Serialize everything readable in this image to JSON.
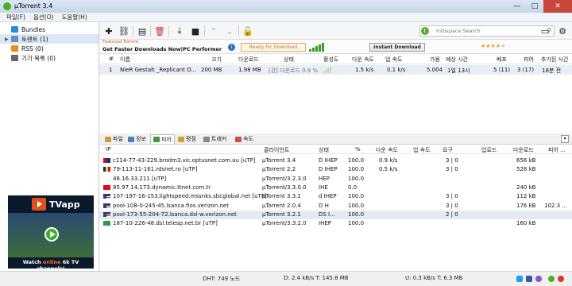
{
  "window": {
    "title": "µTorrent 3.4",
    "controls": [
      "—",
      "□",
      "✕"
    ]
  },
  "menu": [
    "파일(F)",
    "옵션(O)",
    "도움말(H)"
  ],
  "sidebar": {
    "items": [
      {
        "label": "Bundles",
        "color": "#1f8fd6"
      },
      {
        "label": "토렌트 (1)",
        "color": "#6b8fb8"
      },
      {
        "label": "RSS (0)",
        "color": "#f08a1c"
      },
      {
        "label": "기기 목록 (0)",
        "color": "#666666"
      }
    ],
    "ad": {
      "brand": "TVapp",
      "caption_pre": "Watch ",
      "caption_em": "online",
      "caption_post": " 6k TV channels!"
    }
  },
  "toolbar": {
    "buttons": [
      "add-icon",
      "link-icon",
      "file-icon",
      "delete-icon",
      "download-icon",
      "stop-icon",
      "up-icon",
      "down-icon",
      "unlock-icon"
    ],
    "search_placeholder": "Infospace Search",
    "right_icons": [
      "remote-icon",
      "chat-icon",
      "settings-icon"
    ]
  },
  "featured": {
    "label": "Featured Torrent",
    "title": "Get Faster Downloads Now|PC Performer",
    "ready": "Ready for Download",
    "instant": "Instant Download",
    "rating": 4
  },
  "torrents": {
    "columns": [
      "#",
      "이름",
      "크기",
      "다운로드",
      "상태",
      "활성도",
      "다운 속도",
      "업 속도",
      "가용",
      "예상 시간",
      "배포",
      "피어",
      "추가된 시간"
    ],
    "rows": [
      {
        "num": "1",
        "name": "NieR Gestalt _Replicant O...",
        "size": "200 MB",
        "done": "1.98 MB",
        "status": "[강] 다운로드 0.9 %",
        "down": "1.5 k/s",
        "up": "0.1 k/s",
        "avail": "5.004",
        "eta": "1일 13시",
        "seeds": "5 (11)",
        "peers": "3 (17)",
        "added": "18분 전"
      }
    ]
  },
  "tabs": [
    "파일",
    "정보",
    "피어",
    "평점",
    "트래커",
    "속도"
  ],
  "tab_colors": [
    "#c9a04a",
    "#4f7fc2",
    "#3f9a3f",
    "#d7a226",
    "#888888",
    "#d14d4d"
  ],
  "peers": {
    "columns": [
      "IP",
      "클라이언트",
      "상태",
      "%",
      "다운 속도",
      "업 속도",
      "요구",
      "업로드",
      "다운로드",
      "피어 ..."
    ],
    "rows": [
      {
        "flag": "au",
        "ip": "c114-77-43-229.brodm3.vic.optusnet.com.au [uTP]",
        "client": "µTorrent 3.4",
        "flags": "D IHEP",
        "pct": "100.0",
        "down": "0.9 k/s",
        "up": "",
        "req": "3 | 0",
        "upl": "",
        "dl": "656 kB",
        "peer": ""
      },
      {
        "flag": "ru",
        "ip": "79-113-11-161.rdsnet.ro [uTP]",
        "client": "µTorrent 2.2",
        "flags": "D IHEP",
        "pct": "100.0",
        "down": "0.5 k/s",
        "up": "",
        "req": "3 | 0",
        "upl": "",
        "dl": "528 kB",
        "peer": ""
      },
      {
        "flag": "",
        "ip": "46.16.33.211 [uTP]",
        "client": "µTorrent/3.2.3.0",
        "flags": "HEP",
        "pct": "100.0",
        "down": "",
        "up": "",
        "req": "",
        "upl": "",
        "dl": "",
        "peer": ""
      },
      {
        "flag": "tr",
        "ip": "85.97.14.173.dynamic.ttnet.com.tr",
        "client": "µTorrent/3.3.0.0",
        "flags": "IHE",
        "pct": "0.0",
        "down": "",
        "up": "",
        "req": "",
        "upl": "",
        "dl": "240 kB",
        "peer": ""
      },
      {
        "flag": "us",
        "ip": "107-197-16-153.lightspeed.mssnks.sbcglobal.net [uTP]",
        "client": "µTorrent 3.3.1",
        "flags": "d IHEP",
        "pct": "100.0",
        "down": "",
        "up": "",
        "req": "3 | 0",
        "upl": "",
        "dl": "112 kB",
        "peer": ""
      },
      {
        "flag": "us",
        "ip": "pool-108-0-245-45.lsanca.fios.verizon.net",
        "client": "µTorrent 2.0.4",
        "flags": "D H",
        "pct": "100.0",
        "down": "",
        "up": "",
        "req": "3 | 0",
        "upl": "",
        "dl": "176 kB",
        "peer": "102.3 ..."
      },
      {
        "flag": "us",
        "ip": "pool-173-55-204-72.lsanca.dsl-w.verizon.net",
        "client": "µTorrent 3.2.1",
        "flags": "DS I...",
        "pct": "100.0",
        "down": "",
        "up": "",
        "req": "2 | 0",
        "upl": "",
        "dl": "",
        "peer": ""
      },
      {
        "flag": "br",
        "ip": "187-10-226-48.dsl.telesp.net.br [uTP]",
        "client": "µTorrent/3.3.2.0",
        "flags": "IHEP",
        "pct": "100.0",
        "down": "",
        "up": "",
        "req": "",
        "upl": "",
        "dl": "160 kB",
        "peer": ""
      }
    ]
  },
  "status": {
    "dht": "DHT: 749 노드",
    "download": "D: 2.4 kB/s T: 145.8 MB",
    "upload": "U: 0.3 kB/s T: 6.3 MB"
  }
}
